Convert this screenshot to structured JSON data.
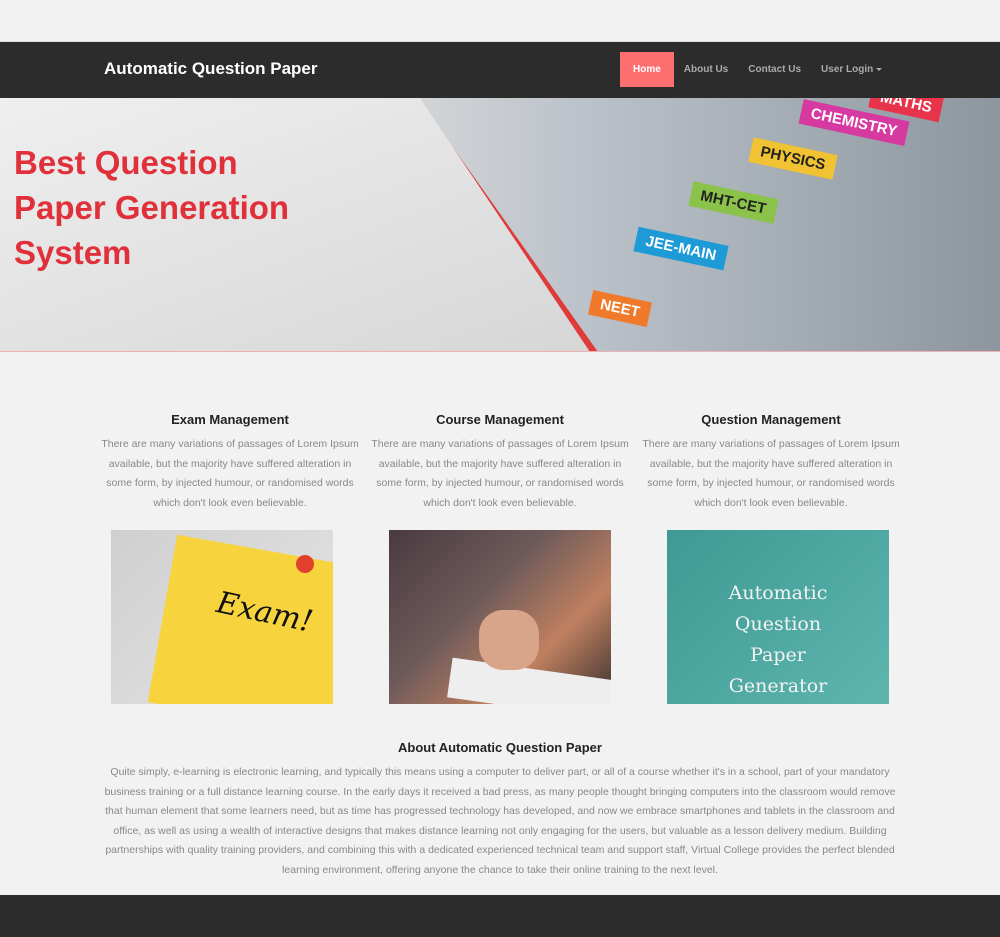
{
  "brand": "Automatic Question Paper",
  "nav": [
    {
      "label": "Home",
      "active": true
    },
    {
      "label": "About Us"
    },
    {
      "label": "Contact Us"
    },
    {
      "label": "User Login"
    }
  ],
  "banner": {
    "headline": [
      "Best Question",
      "Paper Generation",
      "System"
    ],
    "tags": [
      "MATHS",
      "CHEMISTRY",
      "PHYSICS",
      "MHT-CET",
      "JEE-MAIN",
      "NEET"
    ],
    "accent": "#e0313b"
  },
  "features": [
    {
      "title": "Exam Management",
      "text": "There are many variations of passages of Lorem Ipsum available, but the majority have suffered alteration in some form, by injected humour, or randomised words which don't look even believable."
    },
    {
      "title": "Course Management",
      "text": "There are many variations of passages of Lorem Ipsum available, but the majority have suffered alteration in some form, by injected humour, or randomised words which don't look even believable."
    },
    {
      "title": "Question Management",
      "text": "There are many variations of passages of Lorem Ipsum available, but the majority have suffered alteration in some form, by injected humour, or randomised words which don't look even believable."
    }
  ],
  "images": {
    "exam_note": "Exam!",
    "generator_text": "Automatic Question Paper Generator"
  },
  "about": {
    "title": "About Automatic Question Paper",
    "text": "Quite simply, e-learning is electronic learning, and typically this means using a computer to deliver part, or all of a course whether it's in a school, part of your mandatory business training or a full distance learning course. In the early days it received a bad press, as many people thought bringing computers into the classroom would remove that human element that some learners need, but as time has progressed technology has developed, and now we embrace smartphones and tablets in the classroom and office, as well as using a wealth of interactive designs that makes distance learning not only engaging for the users, but valuable as a lesson delivery medium. Building partnerships with quality training providers, and combining this with a dedicated experienced technical team and support staff, Virtual College provides the perfect blended learning environment, offering anyone the chance to take their online training to the next level."
  },
  "colors": {
    "nav_bg": "#2c2c2c",
    "active": "#fd6f6f"
  }
}
